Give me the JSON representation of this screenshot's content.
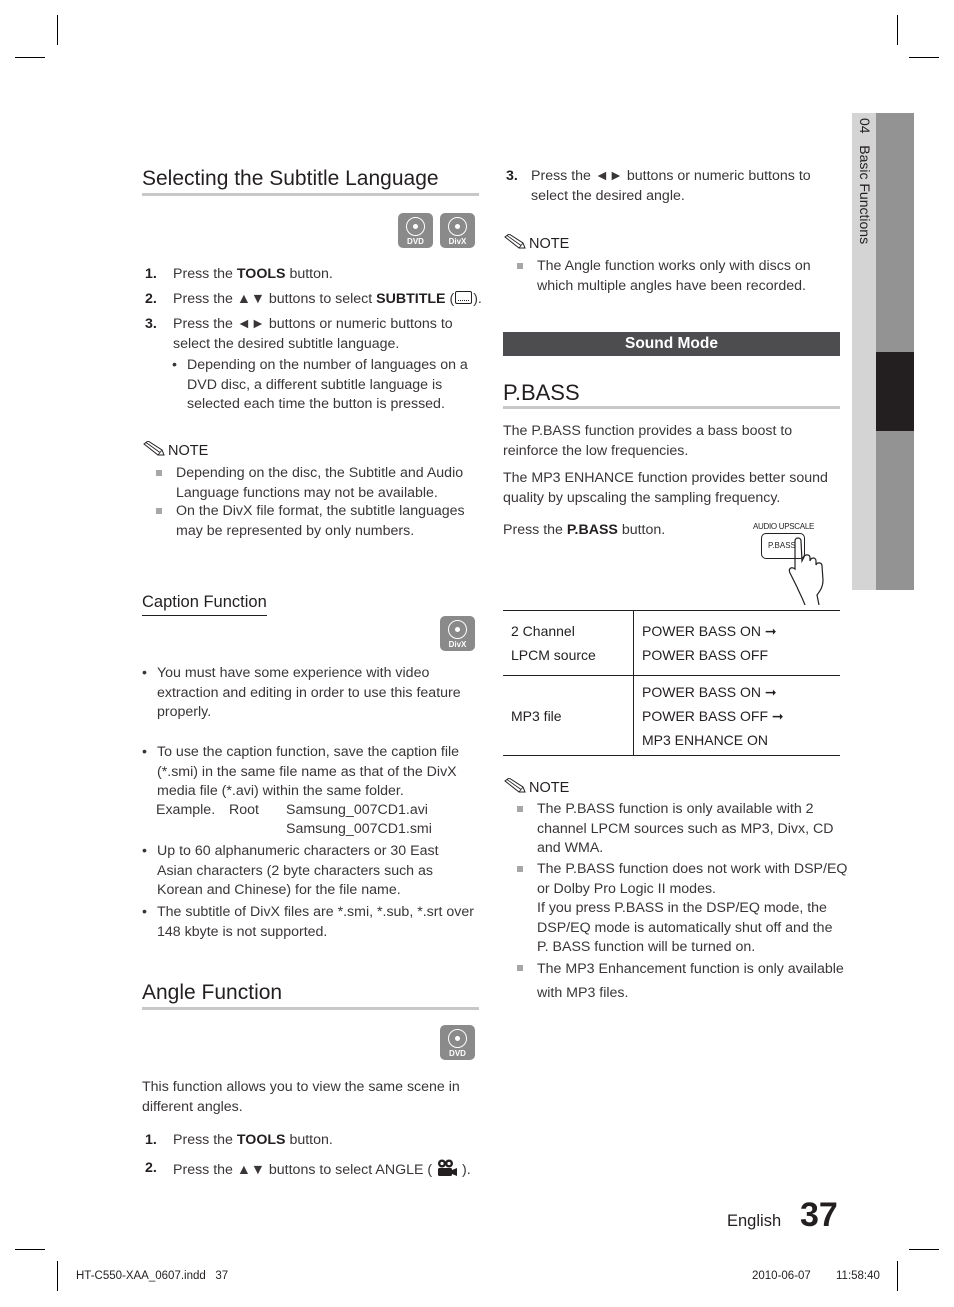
{
  "sidebar_tab": {
    "chapter_number": "04",
    "chapter_title": "Basic Functions"
  },
  "subtitle_section": {
    "title": "Selecting the Subtitle Language",
    "badges": [
      "DVD",
      "DivX"
    ],
    "steps": [
      {
        "num": "1.",
        "pre": "Press the ",
        "bold": "TOOLS",
        "post": " button."
      },
      {
        "num": "2.",
        "pre": "Press the ▲▼ buttons to select ",
        "bold": "SUBTITLE",
        "post": " (",
        "icon": "subtitle-icon",
        "end": ")."
      },
      {
        "num": "3.",
        "lines": [
          "Press the ◄► buttons or numeric buttons to",
          "select the desired subtitle language."
        ]
      }
    ],
    "sub_bullet": [
      "Depending on the number of languages on a",
      "DVD disc, a different subtitle language is",
      "selected each time the button is pressed."
    ],
    "note_label": "NOTE",
    "notes": [
      [
        "Depending on the disc, the Subtitle and Audio",
        "Language functions may not be available."
      ],
      [
        "On the DivX file format, the subtitle languages",
        "may be represented by only numbers."
      ]
    ]
  },
  "caption_section": {
    "title": "Caption Function",
    "badges": [
      "DivX"
    ],
    "bullets": [
      [
        "You must have some experience with video",
        "extraction and editing in order to use this feature",
        "properly."
      ],
      [
        "To use the caption function, save the caption file",
        "(*.smi) in the same file name as that of the DivX",
        "media file (*.avi) within the same folder."
      ],
      [
        "Up to 60 alphanumeric characters or 30 East",
        "Asian characters (2 byte characters such as",
        "Korean and Chinese) for the file name."
      ],
      [
        "The subtitle of DivX files are *.smi, *.sub, *.srt over",
        "148 kbyte is not supported."
      ]
    ],
    "example": {
      "label": "Example.",
      "folder": "Root",
      "files": [
        "Samsung_007CD1.avi",
        "Samsung_007CD1.smi"
      ]
    }
  },
  "angle_section": {
    "title": "Angle Function",
    "badges": [
      "DVD"
    ],
    "intro": [
      "This function allows you to view the same scene in",
      "different angles."
    ],
    "steps": [
      {
        "num": "1.",
        "pre": "Press the ",
        "bold": "TOOLS",
        "post": " button."
      },
      {
        "num": "2.",
        "pre": "Press the ▲▼ buttons to select ANGLE (",
        "icon": "camera-angle-icon",
        "end": ")."
      },
      {
        "num": "3.",
        "lines": [
          "Press the ◄► buttons or numeric buttons to",
          "select the desired angle."
        ]
      }
    ],
    "note_label": "NOTE",
    "notes": [
      [
        "The Angle function works only with discs on",
        "which multiple angles have been recorded."
      ]
    ]
  },
  "sound_mode": {
    "bar_title": "Sound Mode",
    "pbass_title": "P.BASS",
    "paragraphs": [
      [
        "The P.BASS function provides a bass boost to",
        "reinforce the low frequencies."
      ],
      [
        "The MP3 ENHANCE function provides better sound",
        "quality by upscaling the sampling frequency."
      ]
    ],
    "press_pre": "Press the ",
    "press_bold": "P.BASS",
    "press_post": " button.",
    "remote_illustration": {
      "top_label": "AUDIO UPSCALE",
      "button_label": "P.BASS"
    },
    "table": [
      {
        "source": [
          "2 Channel",
          "LPCM source"
        ],
        "modes": [
          "POWER BASS ON ➞",
          "POWER BASS OFF"
        ]
      },
      {
        "source": [
          "MP3 file"
        ],
        "modes": [
          "POWER BASS ON ➞",
          "POWER BASS OFF ➞",
          "MP3 ENHANCE ON"
        ]
      }
    ],
    "note_label": "NOTE",
    "notes": [
      [
        "The P.BASS function is only available with 2",
        "channel LPCM sources such as MP3, Divx, CD",
        "and WMA."
      ],
      [
        "The P.BASS function does not work with DSP/EQ",
        "or Dolby Pro Logic II modes.",
        "If you press P.BASS in the DSP/EQ mode, the",
        "DSP/EQ mode is automatically shut off and the",
        "P. BASS function will be turned on."
      ],
      [
        "The MP3 Enhancement function is only available",
        "with MP3 files."
      ]
    ]
  },
  "footer": {
    "language": "English",
    "page_number": "37",
    "slug_file": "HT-C550-XAA_0607.indd   37",
    "slug_date": "2010-06-07",
    "slug_time": "11:58:40"
  }
}
